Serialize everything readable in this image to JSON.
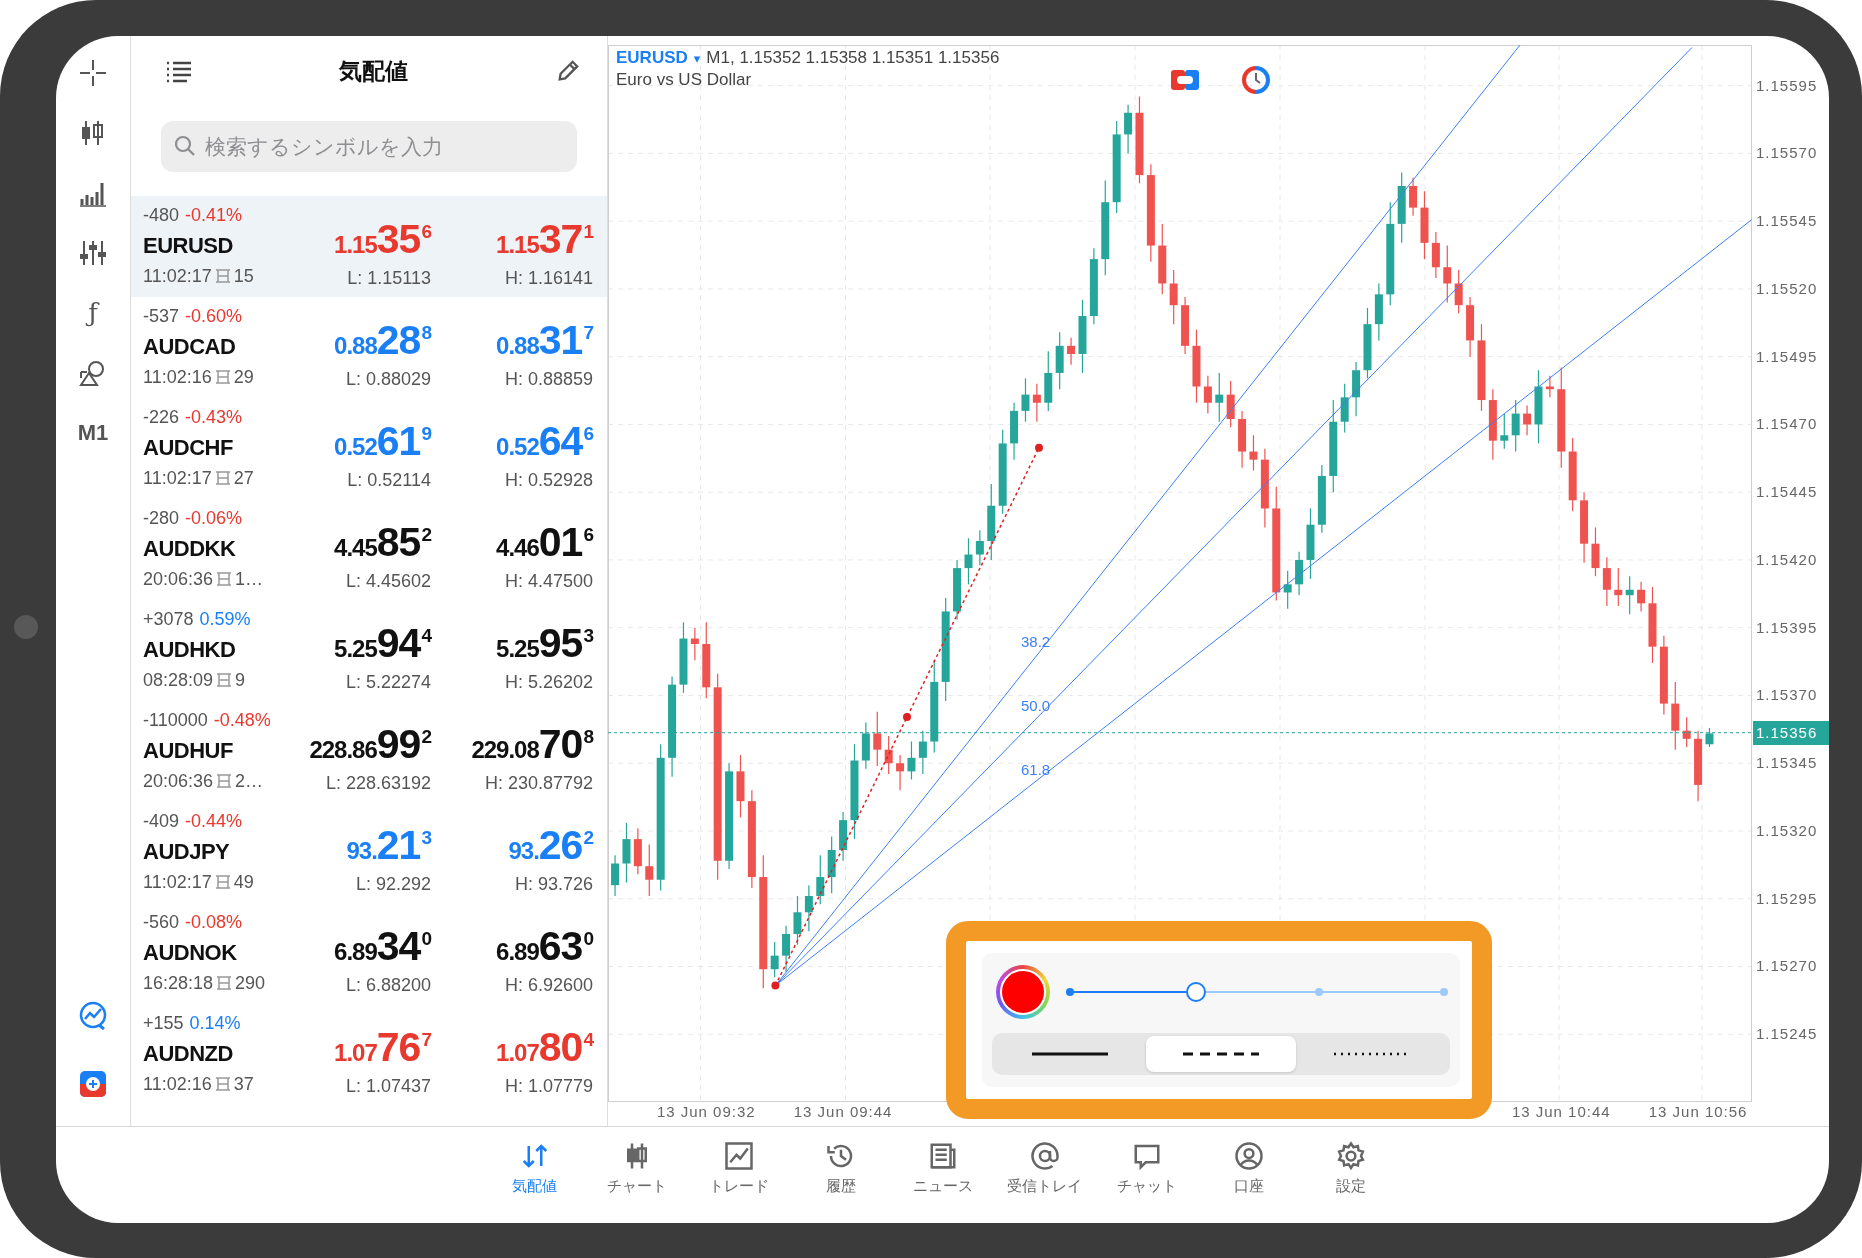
{
  "toolbar": {
    "function_label": "ƒ",
    "timeframe": "M1"
  },
  "quotes_panel": {
    "title": "気配値",
    "search": {
      "placeholder": "検索するシンボルを入力"
    },
    "rows": [
      {
        "selected": true,
        "points": "-480",
        "percent": "-0.41%",
        "falling": true,
        "symbol": "EURUSD",
        "time": "11:02:17",
        "spread": "15",
        "color": "#e8392f",
        "bid": "1.15**35**$^{6}$",
        "low": "L: 1.15113",
        "ask": "1.15**37**$^{1}$",
        "high": "H: 1.16141"
      },
      {
        "selected": false,
        "points": "-537",
        "percent": "-0.60%",
        "falling": true,
        "symbol": "AUDCAD",
        "time": "11:02:16",
        "spread": "29",
        "color": "#1a7ff5",
        "bid": "0.88**28**$^{8}$",
        "low": "L: 0.88029",
        "ask": "0.88**31**$^{7}$",
        "high": "H: 0.88859"
      },
      {
        "selected": false,
        "points": "-226",
        "percent": "-0.43%",
        "falling": true,
        "symbol": "AUDCHF",
        "time": "11:02:17",
        "spread": "27",
        "color": "#1a7ff5",
        "bid": "0.52**61**$^{9}$",
        "low": "L: 0.52114",
        "ask": "0.52**64**$^{6}$",
        "high": "H: 0.52928"
      },
      {
        "selected": false,
        "points": "-280",
        "percent": "-0.06%",
        "falling": true,
        "symbol": "AUDDKK",
        "time": "20:06:36",
        "spread": "1…",
        "color": "#111111",
        "bid": "4.45**85**$^{2}$",
        "low": "L: 4.45602",
        "ask": "4.46**01**$^{6}$",
        "high": "H: 4.47500"
      },
      {
        "selected": false,
        "points": "+3078",
        "percent": "0.59%",
        "falling": false,
        "symbol": "AUDHKD",
        "time": "08:28:09",
        "spread": "9",
        "color": "#111111",
        "bid": "5.25**94**$^{4}$",
        "low": "L: 5.22274",
        "ask": "5.25**95**$^{3}$",
        "high": "H: 5.26202"
      },
      {
        "selected": false,
        "points": "-110000",
        "percent": "-0.48%",
        "falling": true,
        "symbol": "AUDHUF",
        "time": "20:06:36",
        "spread": "2…",
        "color": "#111111",
        "bid": "228.86**99**$^{2}$",
        "low": "L: 228.63192",
        "ask": "229.08**70**$^{8}$",
        "high": "H: 230.87792"
      },
      {
        "selected": false,
        "points": "-409",
        "percent": "-0.44%",
        "falling": true,
        "symbol": "AUDJPY",
        "time": "11:02:17",
        "spread": "49",
        "color": "#1a7ff5",
        "bid": "93.**21**$^{3}$",
        "low": "L: 92.292",
        "ask": "93.**26**$^{2}$",
        "high": "H: 93.726"
      },
      {
        "selected": false,
        "points": "-560",
        "percent": "-0.08%",
        "falling": true,
        "symbol": "AUDNOK",
        "time": "16:28:18",
        "spread": "290",
        "color": "#111111",
        "bid": "6.89**34**$^{0}$",
        "low": "L: 6.88200",
        "ask": "6.89**63**$^{0}$",
        "high": "H: 6.92600"
      },
      {
        "selected": false,
        "points": "+155",
        "percent": "0.14%",
        "falling": false,
        "symbol": "AUDNZD",
        "time": "11:02:16",
        "spread": "37",
        "color": "#e8392f",
        "bid": "1.07**76**$^{7}$",
        "low": "L: 1.07437",
        "ask": "1.07**80**$^{4}$",
        "high": "H: 1.07779"
      }
    ]
  },
  "chart": {
    "symbol": "EURUSD",
    "symbol_caret": "▾",
    "info": "M1, 1.15352 1.15358 1.15351 1.15356",
    "description": "Euro vs US Dollar",
    "current_price": "1.15356",
    "fib_levels": [
      "38.2",
      "50.0",
      "61.8"
    ],
    "chart_data": {
      "type": "candlestick",
      "categories": [
        null,
        null,
        null,
        null,
        null,
        null,
        null,
        null,
        "13 Jun 09:32",
        null,
        null,
        null,
        null,
        null,
        null,
        null,
        null,
        null,
        null,
        null,
        "13 Jun 09:44",
        null,
        null,
        null,
        null,
        null,
        null,
        null,
        null,
        null,
        null,
        null,
        null,
        null,
        null,
        null,
        null,
        null,
        null,
        null,
        null,
        null,
        null,
        null,
        null,
        null,
        null,
        null,
        null,
        null,
        null,
        null,
        null,
        null,
        null,
        null,
        null,
        null,
        null,
        null,
        null,
        null,
        null,
        null,
        null,
        null,
        null,
        null,
        null,
        null,
        null,
        null,
        null,
        null,
        null,
        null,
        null,
        null,
        null,
        null,
        null,
        null,
        null,
        "13 Jun 10:44",
        null,
        null,
        null,
        null,
        null,
        null,
        null,
        null,
        null,
        null,
        null,
        "13 Jun 10:56",
        null
      ],
      "grid": true,
      "ohlc": [
        [
          1.153,
          1.15311,
          1.15296,
          1.15308
        ],
        [
          1.15308,
          1.15323,
          1.15301,
          1.15317
        ],
        [
          1.15317,
          1.15321,
          1.15304,
          1.15307
        ],
        [
          1.15307,
          1.15315,
          1.15296,
          1.15302
        ],
        [
          1.15302,
          1.15352,
          1.15298,
          1.15347
        ],
        [
          1.15347,
          1.15377,
          1.1534,
          1.15374
        ],
        [
          1.15374,
          1.15397,
          1.15371,
          1.15391
        ],
        [
          1.15391,
          1.15395,
          1.15383,
          1.15389
        ],
        [
          1.15389,
          1.15397,
          1.15369,
          1.15373
        ],
        [
          1.15373,
          1.15378,
          1.15302,
          1.15309
        ],
        [
          1.15309,
          1.15345,
          1.15306,
          1.15342
        ],
        [
          1.15342,
          1.15348,
          1.15325,
          1.15331
        ],
        [
          1.15331,
          1.15335,
          1.15299,
          1.15303
        ],
        [
          1.15303,
          1.15311,
          1.15262,
          1.15269
        ],
        [
          1.15269,
          1.15279,
          1.15266,
          1.15274
        ],
        [
          1.15274,
          1.15285,
          1.15268,
          1.15282
        ],
        [
          1.15282,
          1.15296,
          1.15278,
          1.1529
        ],
        [
          1.1529,
          1.153,
          1.15283,
          1.15296
        ],
        [
          1.15296,
          1.15311,
          1.15293,
          1.15303
        ],
        [
          1.15303,
          1.15318,
          1.15297,
          1.15313
        ],
        [
          1.15313,
          1.15327,
          1.15309,
          1.15324
        ],
        [
          1.15324,
          1.15352,
          1.15317,
          1.15346
        ],
        [
          1.15346,
          1.1536,
          1.15343,
          1.15356
        ],
        [
          1.15356,
          1.15364,
          1.15344,
          1.1535
        ],
        [
          1.1535,
          1.15355,
          1.15341,
          1.15345
        ],
        [
          1.15345,
          1.15348,
          1.15335,
          1.15342
        ],
        [
          1.15342,
          1.15353,
          1.15339,
          1.15347
        ],
        [
          1.15347,
          1.15357,
          1.15341,
          1.15353
        ],
        [
          1.15353,
          1.15383,
          1.15349,
          1.15375
        ],
        [
          1.15375,
          1.15406,
          1.15368,
          1.15401
        ],
        [
          1.15401,
          1.1542,
          1.15398,
          1.15417
        ],
        [
          1.15417,
          1.15428,
          1.15411,
          1.15422
        ],
        [
          1.15422,
          1.15431,
          1.15418,
          1.15427
        ],
        [
          1.15427,
          1.15448,
          1.1542,
          1.1544
        ],
        [
          1.1544,
          1.15468,
          1.15437,
          1.15463
        ],
        [
          1.15463,
          1.15478,
          1.15457,
          1.15475
        ],
        [
          1.15475,
          1.15487,
          1.15471,
          1.15481
        ],
        [
          1.15481,
          1.15485,
          1.15471,
          1.15478
        ],
        [
          1.15478,
          1.15497,
          1.15475,
          1.15489
        ],
        [
          1.15489,
          1.15504,
          1.15483,
          1.15499
        ],
        [
          1.15499,
          1.15502,
          1.15492,
          1.15496
        ],
        [
          1.15496,
          1.15516,
          1.15489,
          1.1551
        ],
        [
          1.1551,
          1.15535,
          1.15507,
          1.15531
        ],
        [
          1.15531,
          1.1556,
          1.15525,
          1.15552
        ],
        [
          1.15552,
          1.15582,
          1.15548,
          1.15577
        ],
        [
          1.15577,
          1.15588,
          1.1557,
          1.15585
        ],
        [
          1.15585,
          1.15591,
          1.15559,
          1.15562
        ],
        [
          1.15562,
          1.15566,
          1.1553,
          1.15536
        ],
        [
          1.15536,
          1.15544,
          1.15518,
          1.15522
        ],
        [
          1.15522,
          1.15527,
          1.15507,
          1.15514
        ],
        [
          1.15514,
          1.15517,
          1.15496,
          1.15499
        ],
        [
          1.15499,
          1.15505,
          1.15478,
          1.15484
        ],
        [
          1.15484,
          1.15488,
          1.15474,
          1.15478
        ],
        [
          1.15478,
          1.15489,
          1.15471,
          1.15481
        ],
        [
          1.15481,
          1.15486,
          1.15469,
          1.15472
        ],
        [
          1.15472,
          1.15475,
          1.15454,
          1.1546
        ],
        [
          1.1546,
          1.15466,
          1.15453,
          1.15457
        ],
        [
          1.15457,
          1.15461,
          1.15432,
          1.15439
        ],
        [
          1.15439,
          1.15447,
          1.15405,
          1.15408
        ],
        [
          1.15408,
          1.15416,
          1.15402,
          1.15411
        ],
        [
          1.15411,
          1.15423,
          1.15407,
          1.1542
        ],
        [
          1.1542,
          1.15439,
          1.15413,
          1.15433
        ],
        [
          1.15433,
          1.15455,
          1.1543,
          1.15451
        ],
        [
          1.15451,
          1.15479,
          1.15445,
          1.15471
        ],
        [
          1.15471,
          1.15485,
          1.15467,
          1.1548
        ],
        [
          1.1548,
          1.15493,
          1.15473,
          1.1549
        ],
        [
          1.1549,
          1.15513,
          1.15487,
          1.15507
        ],
        [
          1.15507,
          1.15522,
          1.15501,
          1.15518
        ],
        [
          1.15518,
          1.15552,
          1.15514,
          1.15544
        ],
        [
          1.15544,
          1.15563,
          1.15537,
          1.15558
        ],
        [
          1.15558,
          1.15561,
          1.15547,
          1.1555
        ],
        [
          1.1555,
          1.15556,
          1.15531,
          1.15537
        ],
        [
          1.15537,
          1.15541,
          1.15524,
          1.15528
        ],
        [
          1.15528,
          1.15536,
          1.15515,
          1.15522
        ],
        [
          1.15522,
          1.15527,
          1.15511,
          1.15514
        ],
        [
          1.15514,
          1.15517,
          1.15495,
          1.15501
        ],
        [
          1.15501,
          1.15507,
          1.15475,
          1.15479
        ],
        [
          1.15479,
          1.15483,
          1.15457,
          1.15464
        ],
        [
          1.15464,
          1.15474,
          1.15461,
          1.15466
        ],
        [
          1.15466,
          1.15479,
          1.1546,
          1.15474
        ],
        [
          1.15474,
          1.15477,
          1.15466,
          1.1547
        ],
        [
          1.1547,
          1.1549,
          1.15463,
          1.15484
        ],
        [
          1.15484,
          1.15488,
          1.1548,
          1.15483
        ],
        [
          1.15483,
          1.15491,
          1.15454,
          1.1546
        ],
        [
          1.1546,
          1.15465,
          1.15438,
          1.15442
        ],
        [
          1.15442,
          1.15445,
          1.15419,
          1.15426
        ],
        [
          1.15426,
          1.15432,
          1.15414,
          1.15417
        ],
        [
          1.15417,
          1.15421,
          1.15403,
          1.15409
        ],
        [
          1.15409,
          1.15417,
          1.15403,
          1.15407
        ],
        [
          1.15407,
          1.15414,
          1.154,
          1.15409
        ],
        [
          1.15409,
          1.15412,
          1.15401,
          1.15404
        ],
        [
          1.15404,
          1.1541,
          1.15382,
          1.15388
        ],
        [
          1.15388,
          1.15392,
          1.15363,
          1.15367
        ],
        [
          1.15367,
          1.15375,
          1.1535,
          1.15357
        ],
        [
          1.15357,
          1.15362,
          1.15351,
          1.15354
        ],
        [
          1.15354,
          1.15357,
          1.15331,
          1.15337
        ],
        [
          1.15352,
          1.15358,
          1.15351,
          1.15356
        ]
      ],
      "ylim": [
        1.1522,
        1.1561
      ],
      "yticks": [
        {
          "value": 1.15595,
          "label": "1.15595"
        },
        {
          "value": 1.1557,
          "label": "1.15570"
        },
        {
          "value": 1.15545,
          "label": "1.15545"
        },
        {
          "value": 1.1552,
          "label": "1.15520"
        },
        {
          "value": 1.15495,
          "label": "1.15495"
        },
        {
          "value": 1.1547,
          "label": "1.15470"
        },
        {
          "value": 1.15445,
          "label": "1.15445"
        },
        {
          "value": 1.1542,
          "label": "1.15420"
        },
        {
          "value": 1.15395,
          "label": "1.15395"
        },
        {
          "value": 1.1537,
          "label": "1.15370"
        },
        {
          "value": 1.15345,
          "label": "1.15345"
        },
        {
          "value": 1.1532,
          "label": "1.15320"
        },
        {
          "value": 1.15295,
          "label": "1.15295"
        },
        {
          "value": 1.1527,
          "label": "1.15270"
        },
        {
          "value": 1.15245,
          "label": "1.15245"
        }
      ]
    }
  },
  "line_settings": {
    "color": "#ff0000",
    "width": {
      "level": 0.333
    },
    "styles": [
      {
        "kind": "solid",
        "selected": false
      },
      {
        "kind": "dashed",
        "selected": true
      },
      {
        "kind": "dotted",
        "selected": false
      }
    ]
  },
  "tab_bar": {
    "tabs": [
      {
        "label": "気配値",
        "selected": true
      },
      {
        "label": "チャート",
        "selected": false
      },
      {
        "label": "トレード",
        "selected": false
      },
      {
        "label": "履歴",
        "selected": false
      },
      {
        "label": "ニュース",
        "selected": false
      },
      {
        "label": "受信トレイ",
        "selected": false
      },
      {
        "label": "チャット",
        "selected": false
      },
      {
        "label": "口座",
        "selected": false
      },
      {
        "label": "設定",
        "selected": false
      }
    ]
  }
}
